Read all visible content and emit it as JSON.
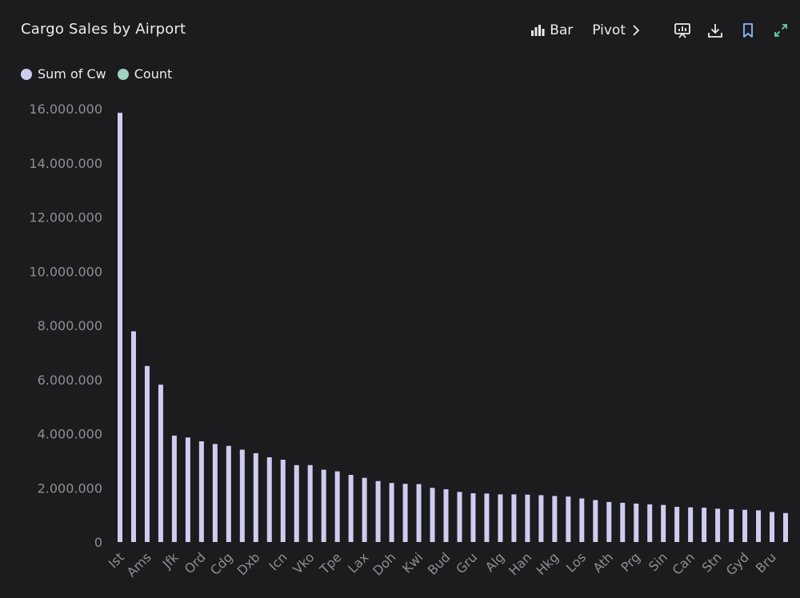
{
  "header": {
    "title": "Cargo Sales by Airport",
    "bar_label": "Bar",
    "pivot_label": "Pivot"
  },
  "colors": {
    "background": "#1c1c1f",
    "series_sum": "#cfcdef",
    "series_count": "#9ed3bf",
    "bookmark": "#8fb6ff",
    "expand": "#5fd3a6"
  },
  "icons": [
    "bar-chart-icon",
    "chevron-right-icon",
    "presentation-icon",
    "download-icon",
    "bookmark-icon",
    "expand-icon"
  ],
  "legend": [
    {
      "label": "Sum of Cw",
      "color": "#cfcdef"
    },
    {
      "label": "Count",
      "color": "#9ed3bf"
    }
  ],
  "chart_data": {
    "type": "bar",
    "title": "Cargo Sales by Airport",
    "ylim": [
      0,
      16000000
    ],
    "yticks": [
      "0",
      "2.000.000",
      "4.000.000",
      "6.000.000",
      "8.000.000",
      "10.000.000",
      "12.000.000",
      "14.000.000",
      "16.000.000"
    ],
    "legend_position": "top-left",
    "grid": false,
    "xtick_labels": [
      "Ist",
      "Ams",
      "Jfk",
      "Ord",
      "Cdg",
      "Dxb",
      "Icn",
      "Vko",
      "Tpe",
      "Lax",
      "Doh",
      "Kwi",
      "Bud",
      "Gru",
      "Alg",
      "Han",
      "Hkg",
      "Los",
      "Ath",
      "Prg",
      "Sin",
      "Can",
      "Stn",
      "Gyd",
      "Bru"
    ],
    "series": [
      {
        "name": "Sum of Cw",
        "values": [
          15850000,
          7780000,
          6500000,
          5810000,
          3930000,
          3860000,
          3720000,
          3620000,
          3550000,
          3410000,
          3280000,
          3130000,
          3040000,
          2840000,
          2840000,
          2670000,
          2610000,
          2480000,
          2370000,
          2250000,
          2180000,
          2150000,
          2140000,
          2000000,
          1950000,
          1850000,
          1800000,
          1790000,
          1760000,
          1760000,
          1750000,
          1730000,
          1700000,
          1680000,
          1610000,
          1550000,
          1480000,
          1450000,
          1420000,
          1390000,
          1370000,
          1300000,
          1280000,
          1270000,
          1230000,
          1210000,
          1190000,
          1170000,
          1110000,
          1070000
        ]
      }
    ]
  }
}
